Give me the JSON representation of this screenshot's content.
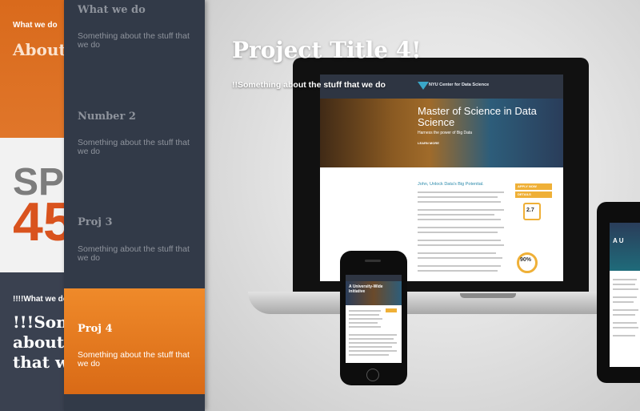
{
  "background_panel": {
    "section1_small": "What we do",
    "section1_big": "About",
    "section2_big_text": "SP",
    "section2_big_number": "45",
    "section3_small": "!!!!What we do",
    "section3_big_lines": [
      "!!!Som",
      "about t",
      "that we"
    ]
  },
  "nav": {
    "items": [
      {
        "title": "What we do",
        "desc": "Something about the stuff that we do",
        "active": false
      },
      {
        "title": "Number 2",
        "desc": "Something about the stuff that we do",
        "active": false
      },
      {
        "title": "Proj 3",
        "desc": "Something about the stuff that we do",
        "active": false
      },
      {
        "title": "Proj 4",
        "desc": "Something about the stuff that we do",
        "active": true
      }
    ]
  },
  "hero": {
    "title": "Project Title 4!",
    "subtitle": "!!Something about the stuff that we do"
  },
  "laptop_site": {
    "logo": "NYU Center for Data Science",
    "banner_title": "Master of Science in Data Science",
    "banner_sub": "Harness the power of Big Data",
    "banner_button": "LEARN MORE",
    "body_title": "John, Unlock Data's Big Potential.",
    "side_btn_1": "APPLY NOW",
    "side_btn_2": "DETAILS",
    "stat_1": "2.7",
    "stat_2": "90%"
  },
  "phone_site": {
    "banner_text": "A University-Wide Initiative"
  },
  "tablet_site": {
    "banner_text": "A U"
  },
  "colors": {
    "accent_orange": "#e87b22",
    "nav_bg": "#323a48",
    "science_blue": "#2b8aab",
    "cta_yellow": "#efb037"
  }
}
